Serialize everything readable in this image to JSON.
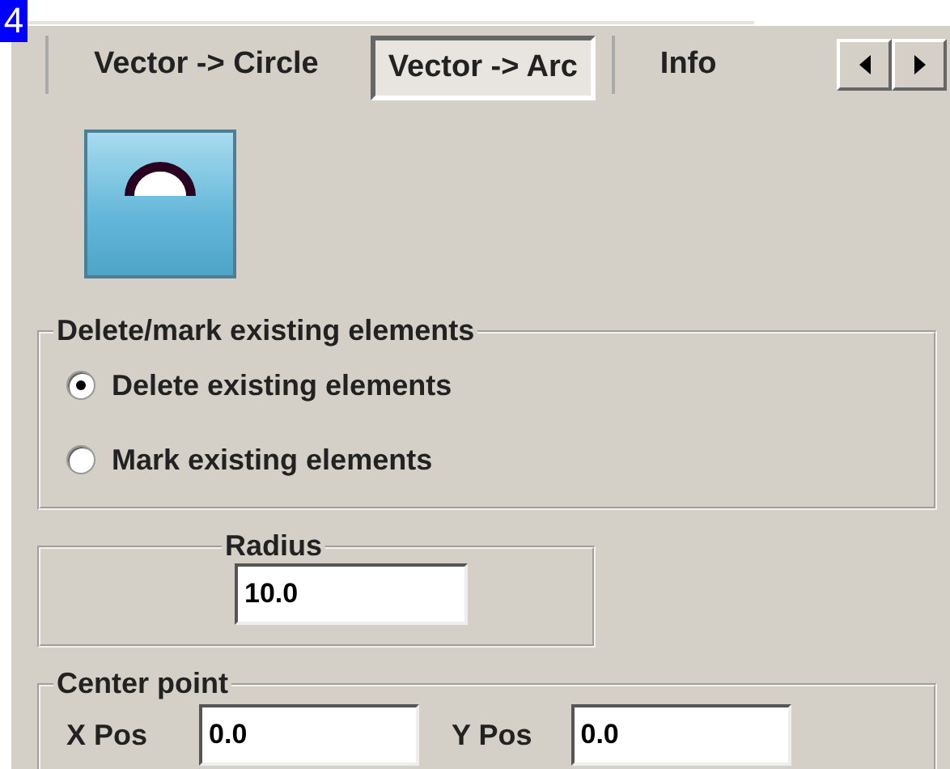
{
  "badge": "4",
  "tabs": [
    {
      "label": "Vector -> Circle",
      "selected": false
    },
    {
      "label": "Vector -> Arc",
      "selected": true
    },
    {
      "label": "Info",
      "selected": false
    }
  ],
  "delete_mark_group": {
    "title": "Delete/mark existing elements",
    "options": [
      {
        "label": "Delete existing elements",
        "selected": true
      },
      {
        "label": "Mark existing elements",
        "selected": false
      }
    ]
  },
  "radius_group": {
    "title": "Radius",
    "value": "10.0"
  },
  "center_point_group": {
    "title": "Center point",
    "fields": [
      {
        "label": "X Pos",
        "value": "0.0"
      },
      {
        "label": "Y Pos",
        "value": "0.0"
      }
    ]
  }
}
